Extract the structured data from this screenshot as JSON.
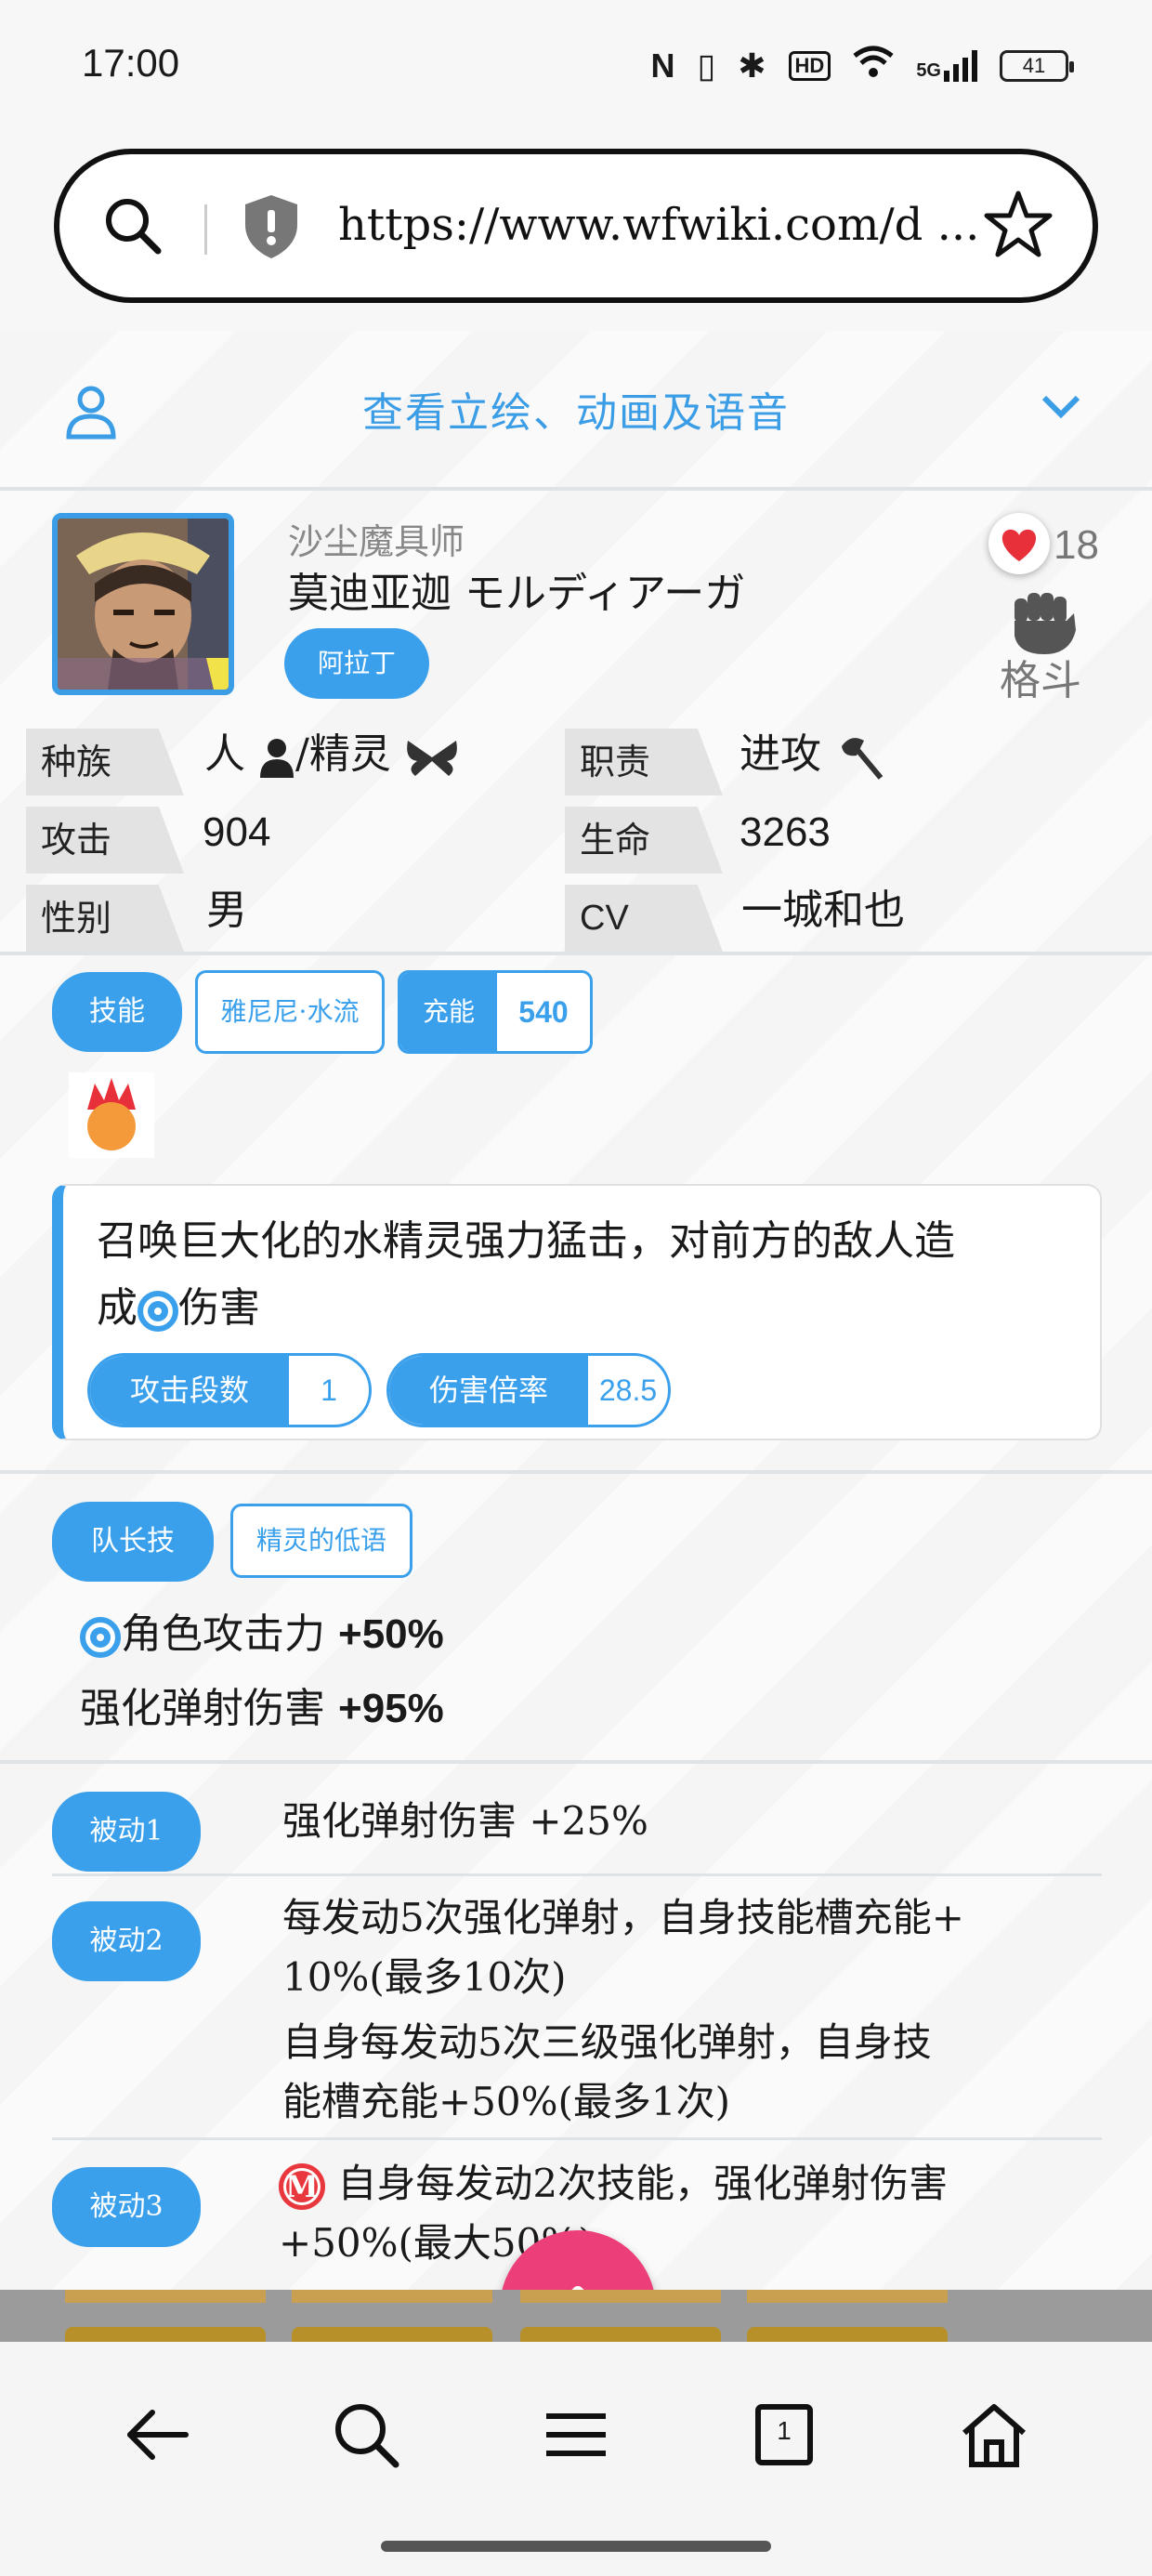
{
  "status_bar": {
    "time": "17:00",
    "battery": "41",
    "network": "5G",
    "hd": "HD"
  },
  "browser": {
    "url": "https://www.wfwiki.com/d ..."
  },
  "banner": {
    "label": "查看立绘、动画及语音"
  },
  "character": {
    "title": "沙尘魔具师",
    "name": "莫迪亚迦 モルディアーガ",
    "tag": "阿拉丁",
    "likes": "18",
    "type": "格斗"
  },
  "stats": {
    "race_label": "种族",
    "race_value": "人",
    "race_sep": "/精灵",
    "role_label": "职责",
    "role_value": "进攻",
    "atk_label": "攻击",
    "atk_value": "904",
    "hp_label": "生命",
    "hp_value": "3263",
    "gender_label": "性别",
    "gender_value": "男",
    "cv_label": "CV",
    "cv_value": "一城和也"
  },
  "skill": {
    "tab_label": "技能",
    "skill_name": "雅尼尼·水流",
    "charge_label": "充能",
    "charge_value": "540",
    "desc_line1": "召唤巨大化的水精灵强力猛击，对前方的敌人造",
    "desc_line2_pre": "成",
    "desc_line2_post": "伤害",
    "hits_label": "攻击段数",
    "hits_value": "1",
    "mult_label": "伤害倍率",
    "mult_value": "28.5"
  },
  "leader": {
    "tab_label": "队长技",
    "name": "精灵的低语",
    "line1_text": "角色攻击力",
    "line1_value": "+50%",
    "line2_text": "强化弹射伤害",
    "line2_value": "+95%"
  },
  "passives": [
    {
      "label": "被动1",
      "text": "强化弹射伤害 +25%"
    },
    {
      "label": "被动2",
      "line1": "每发动5次强化弹射，自身技能槽充能+",
      "line2": "10%(最多10次)",
      "line3": "自身每发动5次三级强化弹射，自身技",
      "line4": "能槽充能+50%(最多1次)"
    },
    {
      "label": "被动3",
      "line1": "自身每发动2次技能，强化弹射伤害",
      "line2": "+50%(最大50%)",
      "icon_letter": "M"
    }
  ],
  "colors": {
    "accent": "#3aa0ec",
    "fab": "#ec3f7a",
    "heart": "#e8303a"
  },
  "icons": [
    "search-icon",
    "shield-icon",
    "star-icon",
    "user-icon",
    "chevron-down-icon",
    "heart-icon",
    "fist-icon",
    "back-icon",
    "menu-icon",
    "tabs-icon",
    "home-icon",
    "arrow-up-icon"
  ],
  "nav": {
    "tab_count": "1"
  }
}
